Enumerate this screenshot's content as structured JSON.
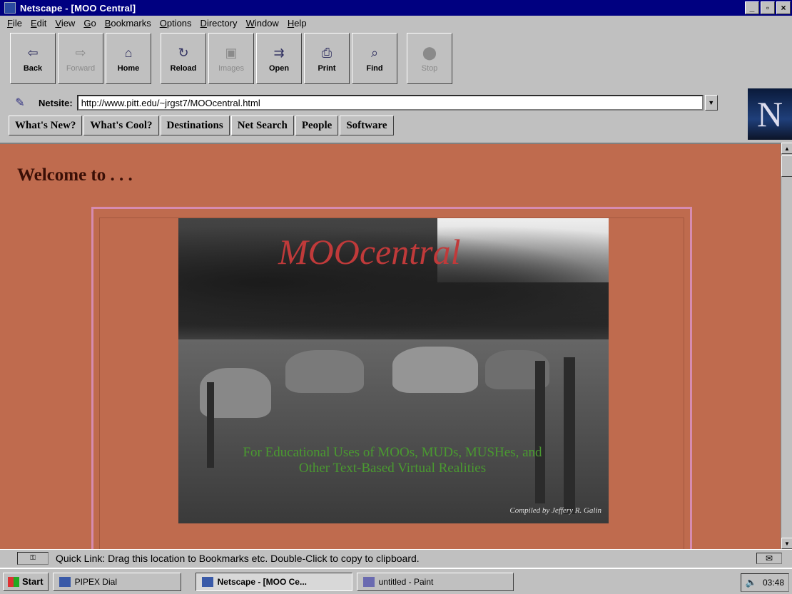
{
  "window": {
    "title": "Netscape - [MOO Central]",
    "controls": [
      "_",
      "▫",
      "×"
    ]
  },
  "menu": [
    "File",
    "Edit",
    "View",
    "Go",
    "Bookmarks",
    "Options",
    "Directory",
    "Window",
    "Help"
  ],
  "toolbar": {
    "back": "Back",
    "forward": "Forward",
    "home": "Home",
    "reload": "Reload",
    "images": "Images",
    "open": "Open",
    "print": "Print",
    "find": "Find",
    "stop": "Stop"
  },
  "location": {
    "label": "Netsite:",
    "url": "http://www.pitt.edu/~jrgst7/MOOcentral.html"
  },
  "directory_buttons": [
    "What's New?",
    "What's Cool?",
    "Destinations",
    "Net Search",
    "People",
    "Software"
  ],
  "brand": {
    "logo_letter": "N"
  },
  "page": {
    "welcome": "Welcome to . . .",
    "banner_title": "MOOcentral",
    "banner_subtitle": "For Educational Uses of MOOs, MUDs, MUSHes, and Other Text-Based Virtual Realities",
    "banner_credit": "Compiled by Jeffery R. Galin",
    "background_color": "#bf6b4e"
  },
  "status": {
    "text": "Quick Link: Drag this location to Bookmarks etc. Double-Click to copy to clipboard."
  },
  "taskbar": {
    "start": "Start",
    "tasks": [
      "PIPEX Dial",
      "Netscape - [MOO Ce...",
      "untitled - Paint"
    ],
    "clock": "03:48"
  }
}
